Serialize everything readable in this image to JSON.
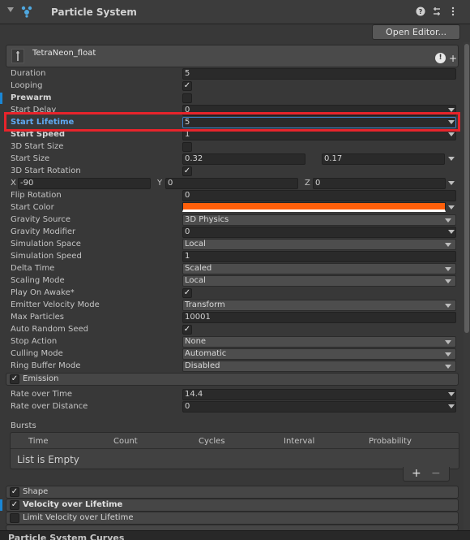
{
  "header": {
    "title": "Particle System",
    "open_editor": "Open Editor..."
  },
  "module": {
    "name": "TetraNeon_float"
  },
  "props": [
    {
      "label": "Duration",
      "value": "5"
    },
    {
      "label": "Looping",
      "checked": true
    },
    {
      "label": "Prewarm",
      "checked": false
    },
    {
      "label": "Start Delay",
      "value": "0"
    },
    {
      "label": "Start Lifetime",
      "value": "5"
    },
    {
      "label": "Start Speed",
      "value": "1"
    },
    {
      "label": "3D Start Size",
      "checked": false
    },
    {
      "label": "Start Size",
      "value1": "0.32",
      "value2": "0.17"
    },
    {
      "label": "3D Start Rotation",
      "checked": true
    },
    {
      "x_label": "X",
      "x": "-90",
      "y_label": "Y",
      "y": "0",
      "z_label": "Z",
      "z": "0"
    },
    {
      "label": "Flip Rotation",
      "value": "0"
    },
    {
      "label": "Start Color",
      "color": "#ff5f0a"
    },
    {
      "label": "Gravity Source",
      "value": "3D Physics"
    },
    {
      "label": "Gravity Modifier",
      "value": "0"
    },
    {
      "label": "Simulation Space",
      "value": "Local"
    },
    {
      "label": "Simulation Speed",
      "value": "1"
    },
    {
      "label": "Delta Time",
      "value": "Scaled"
    },
    {
      "label": "Scaling Mode",
      "value": "Local"
    },
    {
      "label": "Play On Awake*",
      "checked": true
    },
    {
      "label": "Emitter Velocity Mode",
      "value": "Transform"
    },
    {
      "label": "Max Particles",
      "value": "10001"
    },
    {
      "label": "Auto Random Seed",
      "checked": true
    },
    {
      "label": "Stop Action",
      "value": "None"
    },
    {
      "label": "Culling Mode",
      "value": "Automatic"
    },
    {
      "label": "Ring Buffer Mode",
      "value": "Disabled"
    }
  ],
  "emission": {
    "title": "Emission",
    "rate_over_time_label": "Rate over Time",
    "rate_over_time": "14.4",
    "rate_over_distance_label": "Rate over Distance",
    "rate_over_distance": "0",
    "bursts_label": "Bursts",
    "columns": [
      "Time",
      "Count",
      "Cycles",
      "Interval",
      "Probability"
    ],
    "empty_text": "List is Empty",
    "add": "+",
    "remove": "−"
  },
  "sections": [
    {
      "label": "Shape",
      "checked": true
    },
    {
      "label": "Velocity over Lifetime",
      "checked": true
    },
    {
      "label": "Limit Velocity over Lifetime",
      "checked": false
    }
  ],
  "footer": {
    "title": "Particle System Curves"
  },
  "colors": {
    "highlight": "#e8242b",
    "accent": "#1a87d6",
    "start_color": "#ff5f0a"
  }
}
